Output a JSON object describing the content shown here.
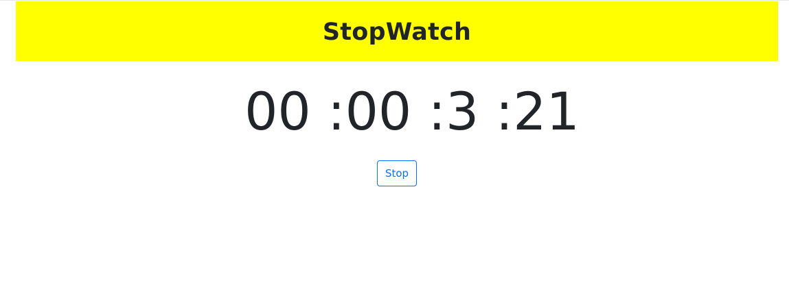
{
  "header": {
    "title": "StopWatch",
    "background_color": "#ffff00"
  },
  "timer": {
    "hours": "00",
    "minutes": ":00",
    "seconds": ":3",
    "centiseconds": ":21"
  },
  "controls": {
    "stop_label": "Stop",
    "accent_color": "#0d6efd"
  }
}
